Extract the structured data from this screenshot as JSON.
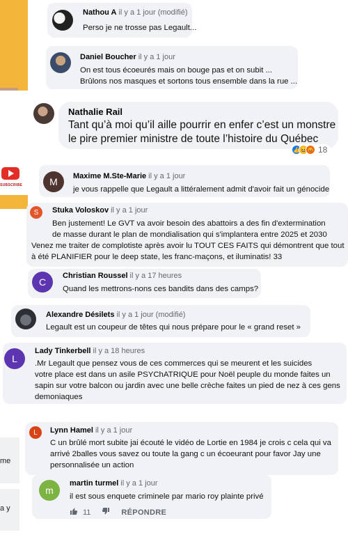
{
  "background": {
    "channel_text": "SUBSCRIBE"
  },
  "edge_fragments": [
    "me",
    "a y"
  ],
  "featured_comment": {
    "name": "Nathalie Rail",
    "lines": [
      "Tant qu’à moi qu’il aille pourrir en enfer c’est un monstre",
      "le pire premier ministre de toute l’histoire du Québec"
    ],
    "reaction_count": "18"
  },
  "comments": [
    {
      "name": "Nathou A",
      "time": "il y a 1 jour (modifié)",
      "lines": [
        "Perso je ne trosse pas Legault..."
      ]
    },
    {
      "name": "Daniel Boucher",
      "time": "il y a 1 jour",
      "lines": [
        "On est tous écoeurés mais on bouge pas et on subit ...",
        "Brûlons nos masques et sortons tous ensemble dans la rue ..."
      ]
    },
    {
      "name": "Maxime M.Ste-Marie",
      "time": "il y a 1 jour",
      "avatar_letter": "M",
      "lines": [
        "je vous rappelle que Legault a littéralement admit d'avoir fait un génocide"
      ]
    },
    {
      "name": "Stuka Voloskov",
      "time": "il y a 1 jour",
      "avatar_letter": "S",
      "lines": [
        "Ben justement! Le GVT va avoir besoin des abattoirs a des fin d'extermination",
        "de masse durant le plan de mondialisation qui s'implantera entre 2025 et 2030",
        "Venez me traiter de complotiste après avoir lu TOUT CES FAITS qui démontrent que tout",
        "à été PLANIFIER pour le deep state, les franc-maçons, et iluminatis! 33"
      ]
    },
    {
      "name": "Christian Roussel",
      "time": "il y a 17 heures",
      "avatar_letter": "C",
      "lines": [
        "Quand les mettrons-nons ces bandits dans des camps?"
      ]
    },
    {
      "name": "Alexandre Désilets",
      "time": "il y a 1 jour (modifié)",
      "lines": [
        "Legault est un coupeur de têtes qui nous prépare pour le « grand reset »"
      ]
    },
    {
      "name": "Lady Tinkerbell",
      "time": "il y a 18 heures",
      "avatar_letter": "L",
      "lines": [
        ".Mr Legault que pensez vous de ces commerces qui se meurent et les suicides",
        "votre place est dans un asile PSYChATRIQUE pour Noël   peuple du monde faites un",
        "sapin sur votre balcon ou jardin avec une belle crèche faites un pied de nez  à ces gens",
        "demoniaques"
      ]
    },
    {
      "name": "Lynn Hamel",
      "time": "il y a 1 jour",
      "avatar_letter": "L",
      "lines": [
        "C un brûlé mort subite jai écouté le vidéo de Lortie en 1984 je crois c cela qui va",
        "arrivé 2balles vous savez ou toute la gang c un écoeurant  pour favor Jay une",
        "personnalisée un action"
      ]
    },
    {
      "name": "martin turmel",
      "time": "il y a 1 jour",
      "avatar_letter": "m",
      "lines": [
        "il est sous enquete criminele par mario roy plainte privé"
      ]
    }
  ],
  "action_bar": {
    "like_count": "11",
    "reply_label": "RÉPONDRE"
  },
  "colors": {
    "bubble": "#f0f2f5",
    "yellow_bg": "#f2b53a",
    "avatar_maxime": "#4e342e",
    "avatar_stuka": "#e2552b",
    "avatar_christian": "#5e35b1",
    "avatar_lady": "#5e35b1",
    "avatar_lynn": "#d84315",
    "avatar_martin": "#7cb342"
  }
}
